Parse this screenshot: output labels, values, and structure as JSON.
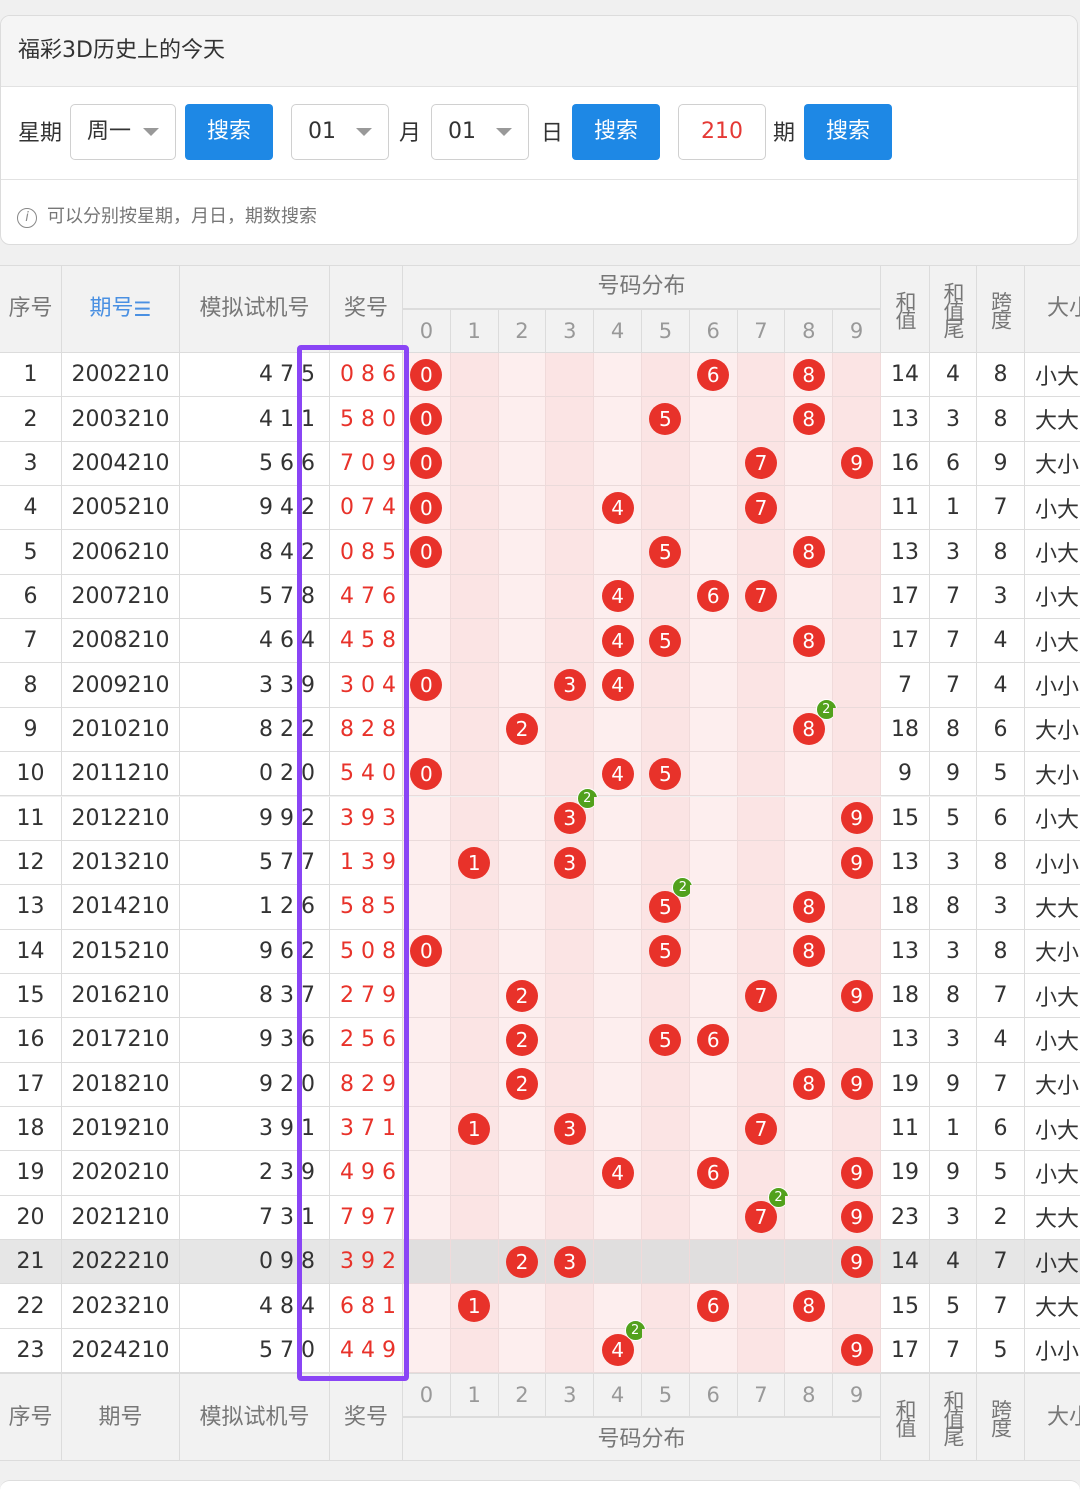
{
  "page_title": "福彩3D历史上的今天",
  "search": {
    "weekday_label": "星期",
    "weekday_value": "周一",
    "search_label": "搜索",
    "month_value": "01",
    "month_label": "月",
    "day_value": "01",
    "day_label": "日",
    "period_value": "210",
    "period_label": "期"
  },
  "hint": "可以分别按星期，月日，期数搜索",
  "table": {
    "headers": {
      "seq": "序号",
      "period": "期号",
      "trial": "模拟试机号",
      "prize": "奖号",
      "distribution": "号码分布",
      "sum": "和值",
      "sum_tail": "和值尾",
      "span": "跨度",
      "size": "大小"
    },
    "digits": [
      "0",
      "1",
      "2",
      "3",
      "4",
      "5",
      "6",
      "7",
      "8",
      "9"
    ],
    "rows": [
      {
        "seq": "1",
        "period": "2002210",
        "trial": "4 7 5",
        "prize": "0 8 6",
        "sum": "14",
        "tail": "4",
        "span": "8",
        "size": "小大"
      },
      {
        "seq": "2",
        "period": "2003210",
        "trial": "4 1 1",
        "prize": "5 8 0",
        "sum": "13",
        "tail": "3",
        "span": "8",
        "size": "大大"
      },
      {
        "seq": "3",
        "period": "2004210",
        "trial": "5 6 6",
        "prize": "7 0 9",
        "sum": "16",
        "tail": "6",
        "span": "9",
        "size": "大小"
      },
      {
        "seq": "4",
        "period": "2005210",
        "trial": "9 4 2",
        "prize": "0 7 4",
        "sum": "11",
        "tail": "1",
        "span": "7",
        "size": "小大"
      },
      {
        "seq": "5",
        "period": "2006210",
        "trial": "8 4 2",
        "prize": "0 8 5",
        "sum": "13",
        "tail": "3",
        "span": "8",
        "size": "小大"
      },
      {
        "seq": "6",
        "period": "2007210",
        "trial": "5 7 8",
        "prize": "4 7 6",
        "sum": "17",
        "tail": "7",
        "span": "3",
        "size": "小大"
      },
      {
        "seq": "7",
        "period": "2008210",
        "trial": "4 6 4",
        "prize": "4 5 8",
        "sum": "17",
        "tail": "7",
        "span": "4",
        "size": "小大"
      },
      {
        "seq": "8",
        "period": "2009210",
        "trial": "3 3 9",
        "prize": "3 0 4",
        "sum": "7",
        "tail": "7",
        "span": "4",
        "size": "小小"
      },
      {
        "seq": "9",
        "period": "2010210",
        "trial": "8 2 2",
        "prize": "8 2 8",
        "sum": "18",
        "tail": "8",
        "span": "6",
        "size": "大小"
      },
      {
        "seq": "10",
        "period": "2011210",
        "trial": "0 2 0",
        "prize": "5 4 0",
        "sum": "9",
        "tail": "9",
        "span": "5",
        "size": "大小"
      },
      {
        "seq": "11",
        "period": "2012210",
        "trial": "9 9 2",
        "prize": "3 9 3",
        "sum": "15",
        "tail": "5",
        "span": "6",
        "size": "小大"
      },
      {
        "seq": "12",
        "period": "2013210",
        "trial": "5 7 7",
        "prize": "1 3 9",
        "sum": "13",
        "tail": "3",
        "span": "8",
        "size": "小小"
      },
      {
        "seq": "13",
        "period": "2014210",
        "trial": "1 2 6",
        "prize": "5 8 5",
        "sum": "18",
        "tail": "8",
        "span": "3",
        "size": "大大"
      },
      {
        "seq": "14",
        "period": "2015210",
        "trial": "9 6 2",
        "prize": "5 0 8",
        "sum": "13",
        "tail": "3",
        "span": "8",
        "size": "大小"
      },
      {
        "seq": "15",
        "period": "2016210",
        "trial": "8 3 7",
        "prize": "2 7 9",
        "sum": "18",
        "tail": "8",
        "span": "7",
        "size": "小大"
      },
      {
        "seq": "16",
        "period": "2017210",
        "trial": "9 3 6",
        "prize": "2 5 6",
        "sum": "13",
        "tail": "3",
        "span": "4",
        "size": "小大"
      },
      {
        "seq": "17",
        "period": "2018210",
        "trial": "9 2 0",
        "prize": "8 2 9",
        "sum": "19",
        "tail": "9",
        "span": "7",
        "size": "大小"
      },
      {
        "seq": "18",
        "period": "2019210",
        "trial": "3 9 1",
        "prize": "3 7 1",
        "sum": "11",
        "tail": "1",
        "span": "6",
        "size": "小大"
      },
      {
        "seq": "19",
        "period": "2020210",
        "trial": "2 3 9",
        "prize": "4 9 6",
        "sum": "19",
        "tail": "9",
        "span": "5",
        "size": "小大"
      },
      {
        "seq": "20",
        "period": "2021210",
        "trial": "7 3 1",
        "prize": "7 9 7",
        "sum": "23",
        "tail": "3",
        "span": "2",
        "size": "大大"
      },
      {
        "seq": "21",
        "period": "2022210",
        "trial": "0 9 8",
        "prize": "3 9 2",
        "sum": "14",
        "tail": "4",
        "span": "7",
        "size": "小大"
      },
      {
        "seq": "22",
        "period": "2023210",
        "trial": "4 8 4",
        "prize": "6 8 1",
        "sum": "15",
        "tail": "5",
        "span": "7",
        "size": "大大"
      },
      {
        "seq": "23",
        "period": "2024210",
        "trial": "5 7 0",
        "prize": "4 4 9",
        "sum": "17",
        "tail": "7",
        "span": "5",
        "size": "小小"
      }
    ],
    "highlighted_row": "21",
    "repeat_badge": "2"
  },
  "colors": {
    "ball": "#e8322a",
    "badge": "#52a11c",
    "accent": "#1e88e5",
    "period_header": "#4a90e2",
    "highlight_box": "#8a45f5"
  },
  "icons": [
    "info-icon",
    "sort-icon",
    "chevron-down-icon"
  ]
}
